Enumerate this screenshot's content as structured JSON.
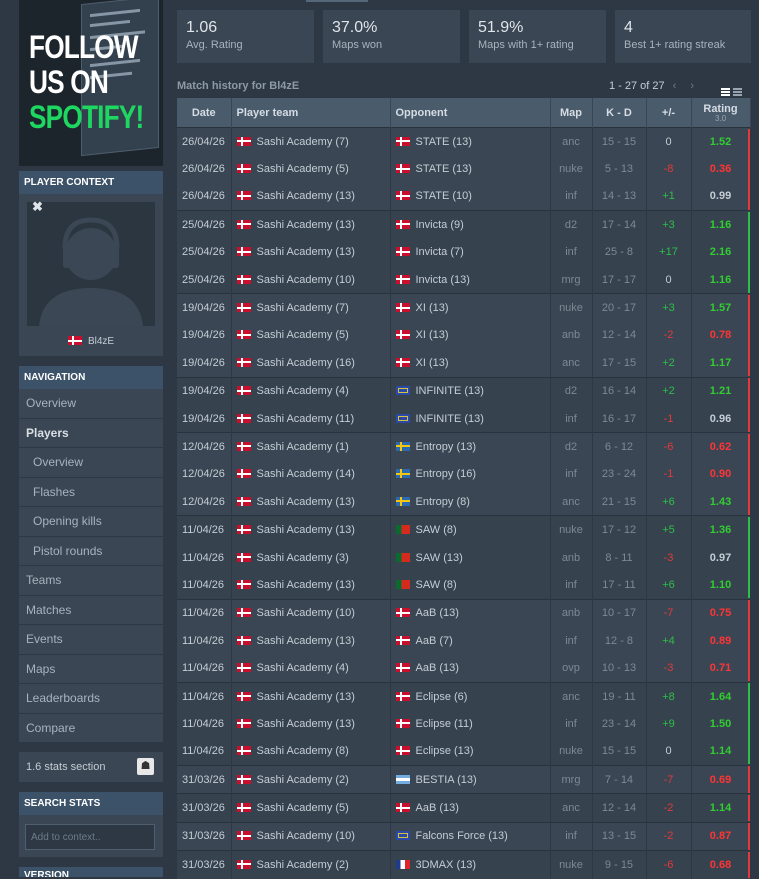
{
  "banner": {
    "line1": "FOLLOW",
    "line2": "US ON",
    "line3": "SPOTIFY!"
  },
  "player_context": {
    "heading": "PLAYER CONTEXT",
    "close_glyph": "✖",
    "player_name": "Bl4zE"
  },
  "navigation": {
    "heading": "NAVIGATION",
    "items": [
      "Overview",
      "Players",
      "Overview",
      "Flashes",
      "Opening kills",
      "Pistol rounds",
      "Teams",
      "Matches",
      "Events",
      "Maps",
      "Leaderboards",
      "Compare"
    ]
  },
  "stats_section": {
    "label": "1.6 stats section"
  },
  "search": {
    "heading": "SEARCH STATS",
    "placeholder": "Add to context.."
  },
  "version_heading": "VERSION",
  "stats": [
    {
      "value": "1.06",
      "label": "Avg. Rating"
    },
    {
      "value": "37.0%",
      "label": "Maps won"
    },
    {
      "value": "51.9%",
      "label": "Maps with 1+ rating"
    },
    {
      "value": "4",
      "label": "Best 1+ rating streak"
    }
  ],
  "history": {
    "title": "Match history for Bl4zE",
    "pagination": "1 - 27 of 27",
    "prev_glyph": "‹",
    "next_glyph": "›",
    "columns": {
      "date": "Date",
      "team": "Player team",
      "opponent": "Opponent",
      "map": "Map",
      "kd": "K - D",
      "diff": "+/-",
      "rating": "Rating",
      "rating_version": "3.0"
    },
    "colors": {
      "win": "#2dbf47",
      "loss": "#e23a3a"
    },
    "rows": [
      {
        "date": "26/04/26",
        "team": "Sashi Academy (7)",
        "opp": "STATE (13)",
        "flag": "dk",
        "map": "anc",
        "kd": "15 - 15",
        "diff": "0",
        "rating": "1.52",
        "result": "loss"
      },
      {
        "date": "26/04/26",
        "team": "Sashi Academy (5)",
        "opp": "STATE (13)",
        "flag": "dk",
        "map": "nuke",
        "kd": "5 - 13",
        "diff": "-8",
        "rating": "0.36",
        "result": "loss"
      },
      {
        "date": "26/04/26",
        "team": "Sashi Academy (13)",
        "opp": "STATE (10)",
        "flag": "dk",
        "map": "inf",
        "kd": "14 - 13",
        "diff": "+1",
        "rating": "0.99",
        "result": "win"
      },
      {
        "date": "25/04/26",
        "team": "Sashi Academy (13)",
        "opp": "Invicta (9)",
        "flag": "dk",
        "map": "d2",
        "kd": "17 - 14",
        "diff": "+3",
        "rating": "1.16",
        "result": "win"
      },
      {
        "date": "25/04/26",
        "team": "Sashi Academy (13)",
        "opp": "Invicta (7)",
        "flag": "dk",
        "map": "inf",
        "kd": "25 - 8",
        "diff": "+17",
        "rating": "2.16",
        "result": "win"
      },
      {
        "date": "25/04/26",
        "team": "Sashi Academy (10)",
        "opp": "Invicta (13)",
        "flag": "dk",
        "map": "mrg",
        "kd": "17 - 17",
        "diff": "0",
        "rating": "1.16",
        "result": "loss"
      },
      {
        "date": "19/04/26",
        "team": "Sashi Academy (7)",
        "opp": "XI (13)",
        "flag": "dk",
        "map": "nuke",
        "kd": "20 - 17",
        "diff": "+3",
        "rating": "1.57",
        "result": "loss"
      },
      {
        "date": "19/04/26",
        "team": "Sashi Academy (5)",
        "opp": "XI (13)",
        "flag": "dk",
        "map": "anb",
        "kd": "12 - 14",
        "diff": "-2",
        "rating": "0.78",
        "result": "loss"
      },
      {
        "date": "19/04/26",
        "team": "Sashi Academy (16)",
        "opp": "XI (13)",
        "flag": "dk",
        "map": "anc",
        "kd": "17 - 15",
        "diff": "+2",
        "rating": "1.17",
        "result": "win"
      },
      {
        "date": "19/04/26",
        "team": "Sashi Academy (4)",
        "opp": "INFINITE (13)",
        "flag": "eu",
        "map": "d2",
        "kd": "16 - 14",
        "diff": "+2",
        "rating": "1.21",
        "result": "loss"
      },
      {
        "date": "19/04/26",
        "team": "Sashi Academy (11)",
        "opp": "INFINITE (13)",
        "flag": "eu",
        "map": "inf",
        "kd": "16 - 17",
        "diff": "-1",
        "rating": "0.96",
        "result": "loss"
      },
      {
        "date": "12/04/26",
        "team": "Sashi Academy (1)",
        "opp": "Entropy (13)",
        "flag": "se",
        "map": "d2",
        "kd": "6 - 12",
        "diff": "-6",
        "rating": "0.62",
        "result": "loss"
      },
      {
        "date": "12/04/26",
        "team": "Sashi Academy (14)",
        "opp": "Entropy (16)",
        "flag": "se",
        "map": "inf",
        "kd": "23 - 24",
        "diff": "-1",
        "rating": "0.90",
        "result": "loss"
      },
      {
        "date": "12/04/26",
        "team": "Sashi Academy (13)",
        "opp": "Entropy (8)",
        "flag": "se",
        "map": "anc",
        "kd": "21 - 15",
        "diff": "+6",
        "rating": "1.43",
        "result": "win"
      },
      {
        "date": "11/04/26",
        "team": "Sashi Academy (13)",
        "opp": "SAW (8)",
        "flag": "pt",
        "map": "nuke",
        "kd": "17 - 12",
        "diff": "+5",
        "rating": "1.36",
        "result": "win"
      },
      {
        "date": "11/04/26",
        "team": "Sashi Academy (3)",
        "opp": "SAW (13)",
        "flag": "pt",
        "map": "anb",
        "kd": "8 - 11",
        "diff": "-3",
        "rating": "0.97",
        "result": "loss"
      },
      {
        "date": "11/04/26",
        "team": "Sashi Academy (13)",
        "opp": "SAW (8)",
        "flag": "pt",
        "map": "inf",
        "kd": "17 - 11",
        "diff": "+6",
        "rating": "1.10",
        "result": "win"
      },
      {
        "date": "11/04/26",
        "team": "Sashi Academy (10)",
        "opp": "AaB (13)",
        "flag": "dk",
        "map": "anb",
        "kd": "10 - 17",
        "diff": "-7",
        "rating": "0.75",
        "result": "loss"
      },
      {
        "date": "11/04/26",
        "team": "Sashi Academy (13)",
        "opp": "AaB (7)",
        "flag": "dk",
        "map": "inf",
        "kd": "12 - 8",
        "diff": "+4",
        "rating": "0.89",
        "result": "win"
      },
      {
        "date": "11/04/26",
        "team": "Sashi Academy (4)",
        "opp": "AaB (13)",
        "flag": "dk",
        "map": "ovp",
        "kd": "10 - 13",
        "diff": "-3",
        "rating": "0.71",
        "result": "loss"
      },
      {
        "date": "11/04/26",
        "team": "Sashi Academy (13)",
        "opp": "Eclipse (6)",
        "flag": "dk",
        "map": "anc",
        "kd": "19 - 11",
        "diff": "+8",
        "rating": "1.64",
        "result": "win"
      },
      {
        "date": "11/04/26",
        "team": "Sashi Academy (13)",
        "opp": "Eclipse (11)",
        "flag": "dk",
        "map": "inf",
        "kd": "23 - 14",
        "diff": "+9",
        "rating": "1.50",
        "result": "win"
      },
      {
        "date": "11/04/26",
        "team": "Sashi Academy (8)",
        "opp": "Eclipse (13)",
        "flag": "dk",
        "map": "nuke",
        "kd": "15 - 15",
        "diff": "0",
        "rating": "1.14",
        "result": "loss"
      },
      {
        "date": "31/03/26",
        "team": "Sashi Academy (2)",
        "opp": "BESTIA (13)",
        "flag": "ar",
        "map": "mrg",
        "kd": "7 - 14",
        "diff": "-7",
        "rating": "0.69",
        "result": "loss"
      },
      {
        "date": "31/03/26",
        "team": "Sashi Academy (5)",
        "opp": "AaB (13)",
        "flag": "dk",
        "map": "anc",
        "kd": "12 - 14",
        "diff": "-2",
        "rating": "1.14",
        "result": "loss"
      },
      {
        "date": "31/03/26",
        "team": "Sashi Academy (10)",
        "opp": "Falcons Force (13)",
        "flag": "eu",
        "map": "inf",
        "kd": "13 - 15",
        "diff": "-2",
        "rating": "0.87",
        "result": "loss"
      },
      {
        "date": "31/03/26",
        "team": "Sashi Academy (2)",
        "opp": "3DMAX (13)",
        "flag": "fr",
        "map": "nuke",
        "kd": "9 - 15",
        "diff": "-6",
        "rating": "0.68",
        "result": "loss"
      }
    ],
    "groups": [
      3,
      3,
      3,
      2,
      3,
      3,
      3,
      3,
      1,
      1,
      1,
      1
    ]
  }
}
